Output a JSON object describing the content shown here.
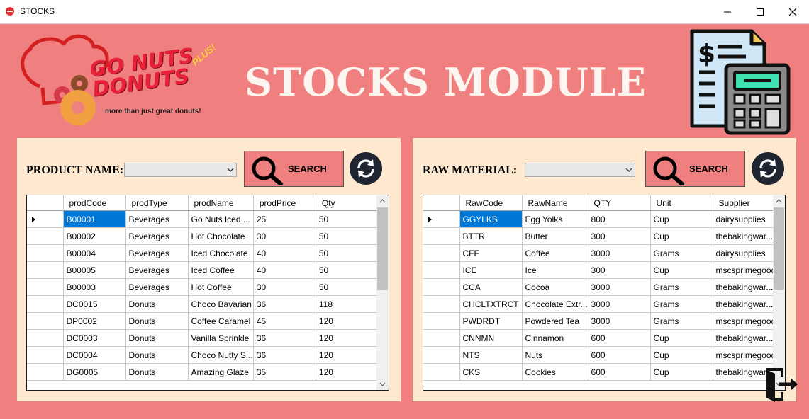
{
  "window": {
    "title": "STOCKS"
  },
  "logo": {
    "line1": "GO NUTS",
    "line2": "DONUTS",
    "badge": "PLUS!",
    "tagline": "more than just great donuts!"
  },
  "module_title": "STOCKS MODULE",
  "products": {
    "label": "PRODUCT NAME:",
    "search_label": "SEARCH",
    "columns": [
      "prodCode",
      "prodType",
      "prodName",
      "prodPrice",
      "Qty"
    ],
    "rows": [
      [
        "B00001",
        "Beverages",
        "Go Nuts Iced ...",
        "25",
        "50"
      ],
      [
        "B00002",
        "Beverages",
        "Hot Chocolate",
        "30",
        "50"
      ],
      [
        "B00004",
        "Beverages",
        "Iced Chocolate",
        "40",
        "50"
      ],
      [
        "B00005",
        "Beverages",
        "Iced Coffee",
        "40",
        "50"
      ],
      [
        "B00003",
        "Beverages",
        "Hot Coffee",
        "30",
        "50"
      ],
      [
        "DC0015",
        "Donuts",
        "Choco Bavarian",
        "36",
        "118"
      ],
      [
        "DP0002",
        "Donuts",
        "Coffee Caramel",
        "45",
        "120"
      ],
      [
        "DC0003",
        "Donuts",
        "Vanilla Sprinkle",
        "36",
        "120"
      ],
      [
        "DC0004",
        "Donuts",
        "Choco Nutty S...",
        "36",
        "120"
      ],
      [
        "DG0005",
        "Donuts",
        "Amazing Glaze",
        "35",
        "120"
      ]
    ]
  },
  "materials": {
    "label": "RAW MATERIAL:",
    "search_label": "SEARCH",
    "columns": [
      "RawCode",
      "RawName",
      "QTY",
      "Unit",
      "Supplier"
    ],
    "rows": [
      [
        "GGYLKS",
        "Egg Yolks",
        "800",
        "Cup",
        "dairysupplies"
      ],
      [
        "BTTR",
        "Butter",
        "300",
        "Cup",
        "thebakingwar..."
      ],
      [
        "CFF",
        "Coffee",
        "3000",
        "Grams",
        "dairysupplies"
      ],
      [
        "ICE",
        "Ice",
        "300",
        "Cup",
        "mscsprimegoods"
      ],
      [
        "CCA",
        "Cocoa",
        "3000",
        "Grams",
        "thebakingwar..."
      ],
      [
        "CHCLTXTRCT",
        "Chocolate Extr...",
        "3000",
        "Grams",
        "thebakingwar..."
      ],
      [
        "PWDRDT",
        "Powdered Tea",
        "3000",
        "Grams",
        "mscsprimegoods"
      ],
      [
        "CNNMN",
        "Cinnamon",
        "600",
        "Cup",
        "thebakingwar..."
      ],
      [
        "NTS",
        "Nuts",
        "600",
        "Cup",
        "mscsprimegoods"
      ],
      [
        "CKS",
        "Cookies",
        "600",
        "Cup",
        "thebakingwar..."
      ]
    ]
  },
  "colors": {
    "background": "#f08080",
    "panel": "#ffe8d0",
    "selection": "#0078d7",
    "title": "#fdf5f0"
  }
}
